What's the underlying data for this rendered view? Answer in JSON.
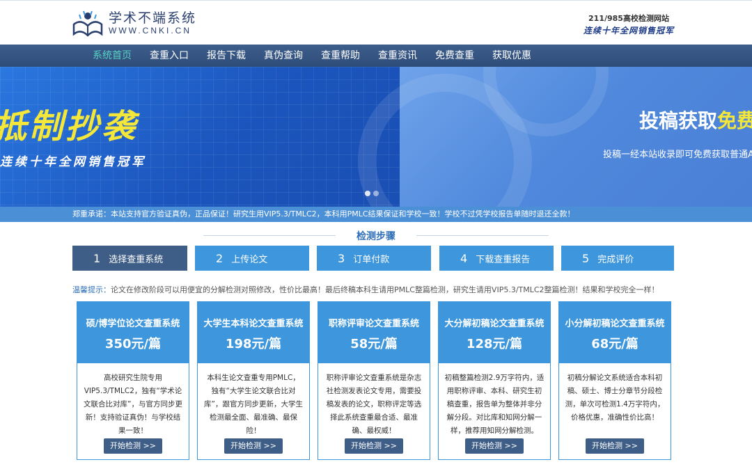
{
  "header": {
    "logo_cn": "学术不端系统",
    "logo_en": "WWW.CNKI.CN",
    "right_line1": "211/985高校检测网站",
    "right_line2": "连续十年全网销售冠军"
  },
  "nav": {
    "items": [
      {
        "label": "系统首页",
        "active": true
      },
      {
        "label": "查重入口"
      },
      {
        "label": "报告下载"
      },
      {
        "label": "真伪查询"
      },
      {
        "label": "查重帮助"
      },
      {
        "label": "查重资讯"
      },
      {
        "label": "免费查重"
      },
      {
        "label": "获取优惠"
      }
    ]
  },
  "banner": {
    "left_big": "抵制抄袭",
    "left_slogan": "连续十年全网销售冠军",
    "right_title_a": "投稿获取",
    "right_title_b": "免费",
    "right_sub": "投稿一经本站收录即可免费获取普通AML"
  },
  "notice": "郑重承诺：本站支持官方验证真伪，正品保证！研究生用VIP5.3/TMLC2，本科用PMLC结果保证和学校一致！学校不过凭学校报告单随时退还全款！",
  "steps": {
    "title": "检测步骤",
    "items": [
      {
        "num": "1",
        "label": "选择查重系统"
      },
      {
        "num": "2",
        "label": "上传论文"
      },
      {
        "num": "3",
        "label": "订单付款"
      },
      {
        "num": "4",
        "label": "下载查重报告"
      },
      {
        "num": "5",
        "label": "完成评价"
      }
    ]
  },
  "tip": {
    "prefix": "温馨提示：",
    "text": "论文在修改阶段可以用便宜的分解检测对照修改，性价比最高！最后终稿本科生请用PMLC整篇检测，研究生请用VIP5.3/TMLC2整篇检测！结果和学校完全一样！"
  },
  "cards": [
    {
      "name": "硕/博学位论文查重系统",
      "price": "350元/篇",
      "desc": "高校研究生院专用VIP5.3/TMLC2，独有“学术论文联合比对库”，与官方同步更新！支持验证真伪！与学校结果一致！",
      "button": "开始检测 >>"
    },
    {
      "name": "大学生本科论文查重系统",
      "price": "198元/篇",
      "desc": "本科生论文查重专用PMLC，独有“大学生论文联合比对库”，跟官方同步更新，大学生检测最全面、最准确、最保险！",
      "button": "开始检测 >>"
    },
    {
      "name": "职称评审论文查重系统",
      "price": "58元/篇",
      "desc": "职称评审论文查重系统是杂志社检测发表论文专用，需要投稿发表的论文，职称评定等选择此系统查重最合适、最准确、最权威！",
      "button": "开始检测 >>"
    },
    {
      "name": "大分解初稿论文查重系统",
      "price": "128元/篇",
      "desc": "初稿整篇检测2.9万字符内，适用职称评审、本科、研究生初稿查重，报告单为整体并非分解分段。对比库和知网分解一样，推荐用知网分解检测。",
      "button": "开始检测 >>"
    },
    {
      "name": "小分解初稿论文查重系统",
      "price": "68元/篇",
      "desc": "初稿分解论文系统适合本科初稿、硕士、博士分章节分段检测，单次可检测1.4万字符内，价格优惠，准确性价比高！",
      "button": "开始检测 >>"
    }
  ]
}
